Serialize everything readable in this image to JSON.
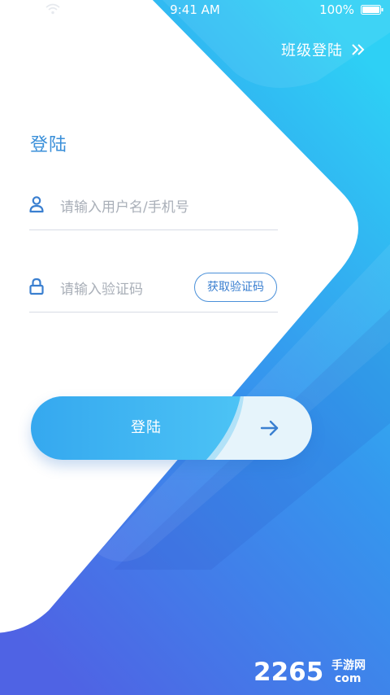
{
  "status_bar": {
    "time": "9:41 AM",
    "battery": "100%"
  },
  "header": {
    "class_login_label": "班级登陆"
  },
  "form": {
    "title": "登陆",
    "username_placeholder": "请输入用户名/手机号",
    "code_placeholder": "请输入验证码",
    "get_code_label": "获取验证码",
    "submit_label": "登陆"
  },
  "watermark": {
    "logo_text": "2265 手游网",
    "logo_sub": "com"
  },
  "colors": {
    "accent": "#3a8fd9",
    "gradient_top": "#2ec4f3",
    "gradient_bottom": "#4d6be6",
    "button_light": "#e6f4fb"
  },
  "icons": {
    "user": "user-icon",
    "lock": "lock-icon",
    "arrow": "arrow-right-icon",
    "chevrons": "double-chevron-right-icon",
    "wifi": "wifi-icon",
    "battery": "battery-icon"
  }
}
